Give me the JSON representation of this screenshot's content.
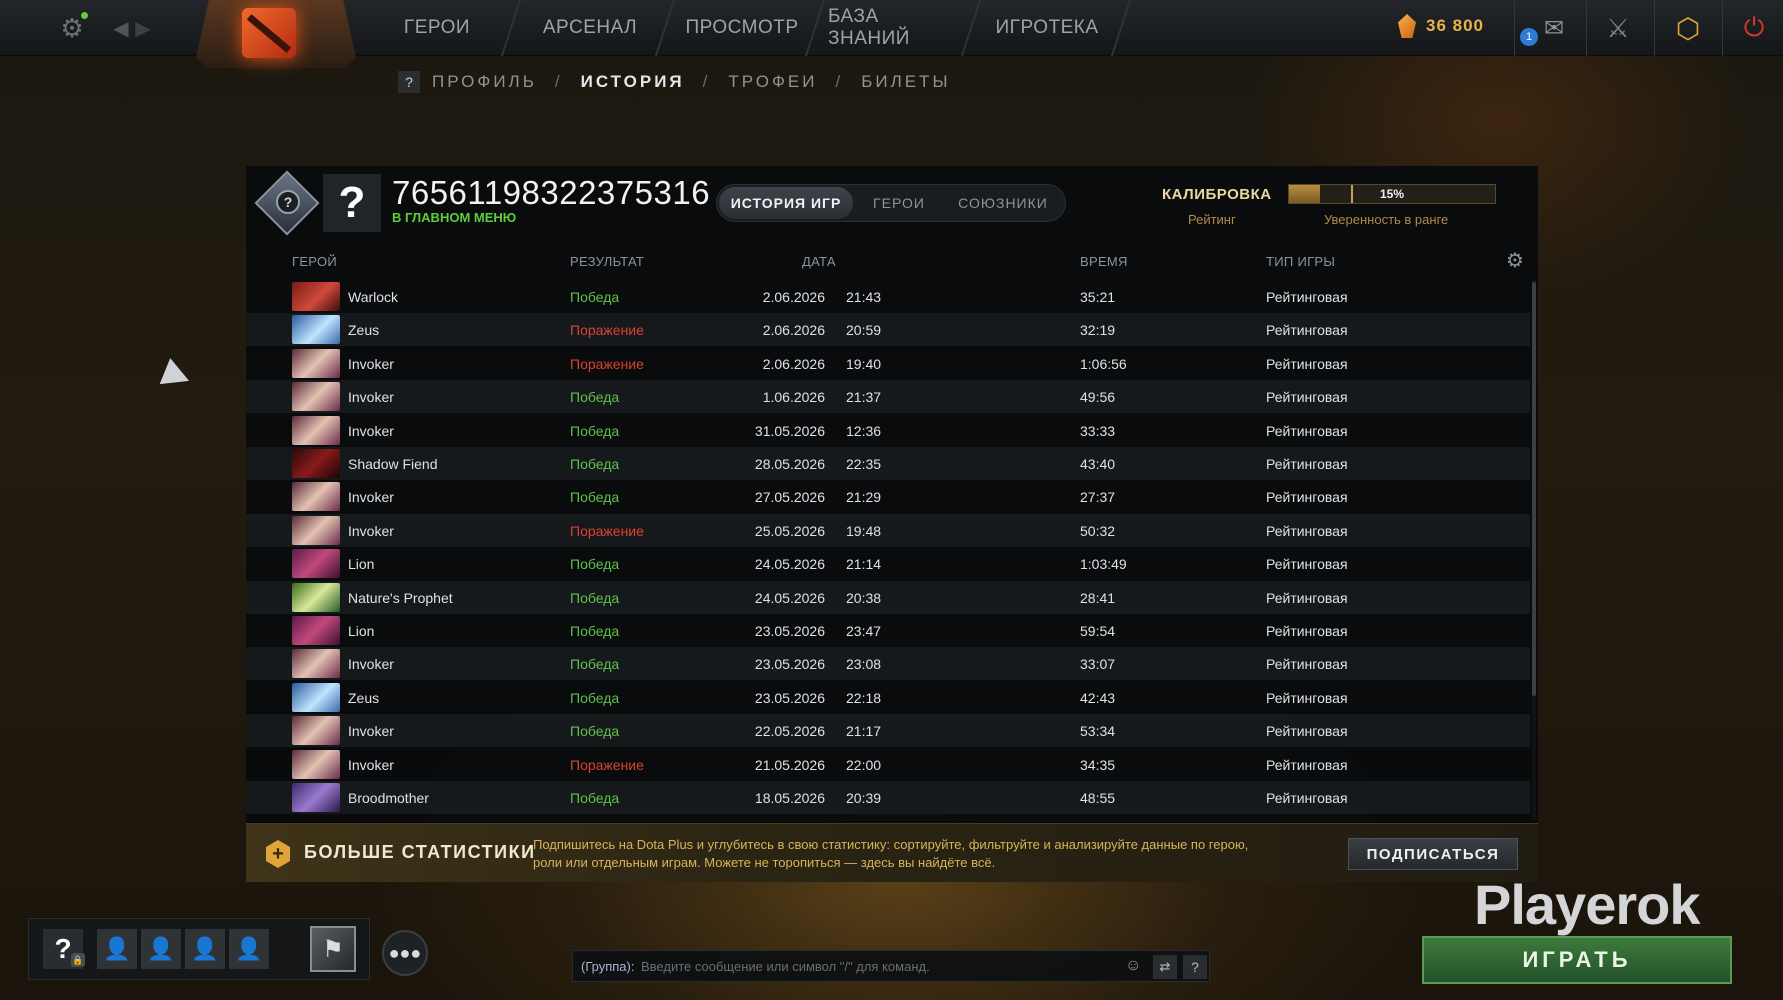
{
  "nav": {
    "items": [
      "ГЕРОИ",
      "АРСЕНАЛ",
      "ПРОСМОТР",
      "БАЗА ЗНАНИЙ",
      "ИГРОТЕКА"
    ],
    "shards": "36 800",
    "mail_count": "1"
  },
  "breadcrumb": {
    "help": "?",
    "profile": "ПРОФИЛЬ",
    "history": "ИСТОРИЯ",
    "trophies": "ТРОФЕИ",
    "tickets": "БИЛЕТЫ"
  },
  "profile": {
    "avatar": "?",
    "rank_badge": "?",
    "steam_id": "76561198322375316",
    "status": "В ГЛАВНОМ МЕНЮ"
  },
  "tabs": {
    "history": "ИСТОРИЯ ИГР",
    "heroes": "ГЕРОИ",
    "allies": "СОЮЗНИКИ"
  },
  "calibration": {
    "title": "КАЛИБРОВКА",
    "rating_label": "Рейтинг",
    "confidence_value": "15%",
    "confidence_fraction": 0.15,
    "confidence_label": "Уверенность в ранге"
  },
  "table": {
    "headers": {
      "hero": "ГЕРОЙ",
      "result": "РЕЗУЛЬТАТ",
      "date": "ДАТА",
      "duration": "ВРЕМЯ",
      "mode": "ТИП ИГРЫ"
    },
    "rows": [
      {
        "hero": "Warlock",
        "result": "Победа",
        "outcome": "win",
        "date": "2.06.2026",
        "time": "21:43",
        "duration": "35:21",
        "mode": "Рейтинговая"
      },
      {
        "hero": "Zeus",
        "result": "Поражение",
        "outcome": "loss",
        "date": "2.06.2026",
        "time": "20:59",
        "duration": "32:19",
        "mode": "Рейтинговая"
      },
      {
        "hero": "Invoker",
        "result": "Поражение",
        "outcome": "loss",
        "date": "2.06.2026",
        "time": "19:40",
        "duration": "1:06:56",
        "mode": "Рейтинговая"
      },
      {
        "hero": "Invoker",
        "result": "Победа",
        "outcome": "win",
        "date": "1.06.2026",
        "time": "21:37",
        "duration": "49:56",
        "mode": "Рейтинговая"
      },
      {
        "hero": "Invoker",
        "result": "Победа",
        "outcome": "win",
        "date": "31.05.2026",
        "time": "12:36",
        "duration": "33:33",
        "mode": "Рейтинговая"
      },
      {
        "hero": "Shadow Fiend",
        "result": "Победа",
        "outcome": "win",
        "date": "28.05.2026",
        "time": "22:35",
        "duration": "43:40",
        "mode": "Рейтинговая"
      },
      {
        "hero": "Invoker",
        "result": "Победа",
        "outcome": "win",
        "date": "27.05.2026",
        "time": "21:29",
        "duration": "27:37",
        "mode": "Рейтинговая"
      },
      {
        "hero": "Invoker",
        "result": "Поражение",
        "outcome": "loss",
        "date": "25.05.2026",
        "time": "19:48",
        "duration": "50:32",
        "mode": "Рейтинговая"
      },
      {
        "hero": "Lion",
        "result": "Победа",
        "outcome": "win",
        "date": "24.05.2026",
        "time": "21:14",
        "duration": "1:03:49",
        "mode": "Рейтинговая"
      },
      {
        "hero": "Nature's Prophet",
        "result": "Победа",
        "outcome": "win",
        "date": "24.05.2026",
        "time": "20:38",
        "duration": "28:41",
        "mode": "Рейтинговая"
      },
      {
        "hero": "Lion",
        "result": "Победа",
        "outcome": "win",
        "date": "23.05.2026",
        "time": "23:47",
        "duration": "59:54",
        "mode": "Рейтинговая"
      },
      {
        "hero": "Invoker",
        "result": "Победа",
        "outcome": "win",
        "date": "23.05.2026",
        "time": "23:08",
        "duration": "33:07",
        "mode": "Рейтинговая"
      },
      {
        "hero": "Zeus",
        "result": "Победа",
        "outcome": "win",
        "date": "23.05.2026",
        "time": "22:18",
        "duration": "42:43",
        "mode": "Рейтинговая"
      },
      {
        "hero": "Invoker",
        "result": "Победа",
        "outcome": "win",
        "date": "22.05.2026",
        "time": "21:17",
        "duration": "53:34",
        "mode": "Рейтинговая"
      },
      {
        "hero": "Invoker",
        "result": "Поражение",
        "outcome": "loss",
        "date": "21.05.2026",
        "time": "22:00",
        "duration": "34:35",
        "mode": "Рейтинговая"
      },
      {
        "hero": "Broodmother",
        "result": "Победа",
        "outcome": "win",
        "date": "18.05.2026",
        "time": "20:39",
        "duration": "48:55",
        "mode": "Рейтинговая"
      }
    ]
  },
  "banner": {
    "title": "БОЛЬШЕ СТАТИСТИКИ",
    "text": "Подпишитесь на Dota Plus и углубитесь в свою статистику: сортируйте, фильтруйте и анализируйте данные по герою, роли или отдельным играм. Можете не торопиться — здесь вы найдёте всё.",
    "button": "ПОДПИСАТЬСЯ"
  },
  "party": {
    "help": "?"
  },
  "chat": {
    "label": "(Группа):",
    "placeholder": "Введите сообщение или символ \"/\" для команд.",
    "help": "?"
  },
  "watermark": "Playerok",
  "play_button": "ИГРАТЬ",
  "colors": {
    "win": "#5ec24a",
    "loss": "#d9432e",
    "accent_gold": "#e0a53a",
    "play_green": "#3e7a3c"
  },
  "icons": {
    "settings": "gear-icon",
    "back": "arrow-left-icon",
    "forward": "arrow-right-icon",
    "shards": "shard-icon",
    "mail": "mail-icon",
    "armory": "armory-icon",
    "dota_plus": "dota-plus-icon",
    "power": "power-icon"
  }
}
